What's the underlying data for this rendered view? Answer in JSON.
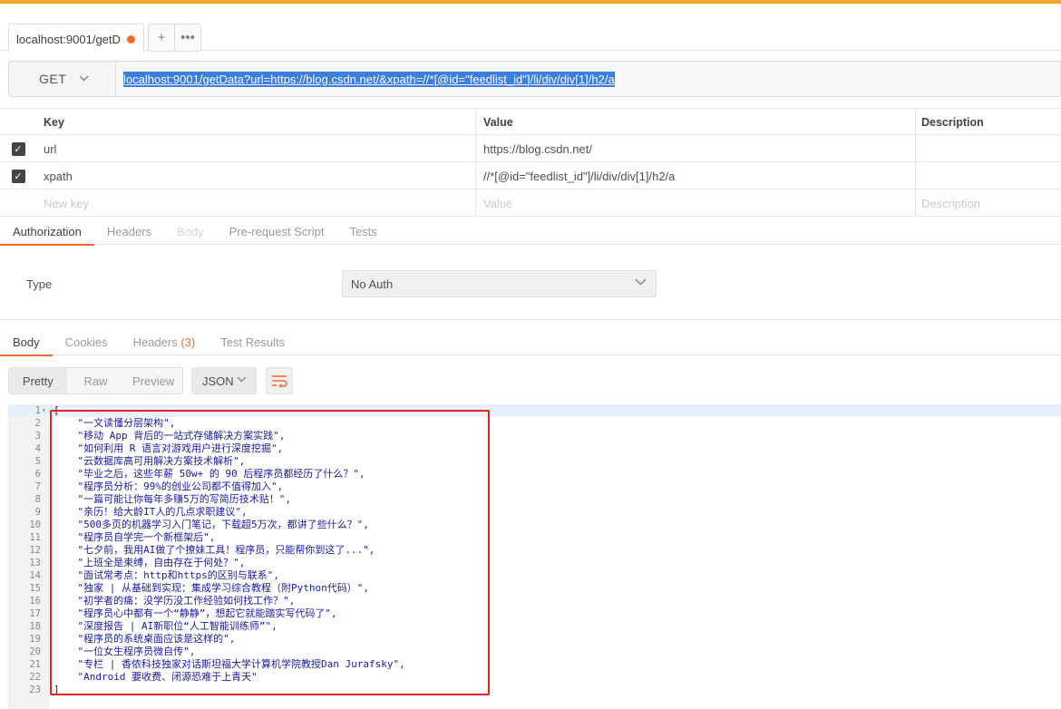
{
  "tab": {
    "title": "localhost:9001/getD",
    "add_label": "+",
    "more_label": "•••"
  },
  "request": {
    "method": "GET",
    "url": "localhost:9001/getData?url=https://blog.csdn.net/&xpath=//*[@id=\"feedlist_id\"]/li/div/div[1]/h2/a"
  },
  "params": {
    "headers": {
      "key": "Key",
      "value": "Value",
      "description": "Description"
    },
    "rows": [
      {
        "key": "url",
        "value": "https://blog.csdn.net/",
        "checked": true
      },
      {
        "key": "xpath",
        "value": "//*[@id=\"feedlist_id\"]/li/div/div[1]/h2/a",
        "checked": true
      }
    ],
    "new_key_placeholder": "New key",
    "new_value_placeholder": "Value",
    "new_desc_placeholder": "Description"
  },
  "request_tabs": [
    "Authorization",
    "Headers",
    "Body",
    "Pre-request Script",
    "Tests"
  ],
  "auth": {
    "type_label": "Type",
    "selected": "No Auth"
  },
  "response_tabs": {
    "body": "Body",
    "cookies": "Cookies",
    "headers": "Headers",
    "headers_count": "(3)",
    "tests": "Test Results"
  },
  "view_modes": [
    "Pretty",
    "Raw",
    "Preview"
  ],
  "format": "JSON",
  "colors": {
    "accent": "#f26b2b",
    "highlight_box": "#e62222",
    "url_selection": "#3b7ee0"
  },
  "response_lines": [
    "[",
    "    \"一文读懂分层架构\",",
    "    \"移动 App 背后的一站式存储解决方案实践\",",
    "    \"如何利用 R 语言对游戏用户进行深度挖掘\",",
    "    \"云数据库高可用解决方案技术解析\",",
    "    \"毕业之后，这些年薪 50w+ 的 90 后程序员都经历了什么？\",",
    "    \"程序员分析：99%的创业公司都不值得加入\",",
    "    \"一篇可能让你每年多赚5万的写简历技术贴！\",",
    "    \"亲历！给大龄IT人的几点求职建议\",",
    "    \"500多页的机器学习入门笔记，下载超5万次，都讲了些什么？\",",
    "    \"程序员自学完一个新框架后\",",
    "    \"七夕前，我用AI做了个撩妹工具！程序员，只能帮你到这了...\",",
    "    \"上班全是束缚，自由存在于何处？\",",
    "    \"面试常考点：http和https的区别与联系\",",
    "    \"独家 | 从基础到实现：集成学习综合教程（附Python代码）\",",
    "    \"初学者的痛：没学历没工作经验如何找工作？\",",
    "    \"程序员心中都有一个“静静”，想起它就能踏实写代码了\",",
    "    \"深度报告 | AI新职位“人工智能训练师”\",",
    "    \"程序员的系统桌面应该是这样的\",",
    "    \"一位女生程序员微自传\",",
    "    \"专栏 | 香侬科技独家对话斯坦福大学计算机学院教授Dan Jurafsky\",",
    "    \"Android 要收费、闭源恐难于上青天\"",
    "]"
  ]
}
